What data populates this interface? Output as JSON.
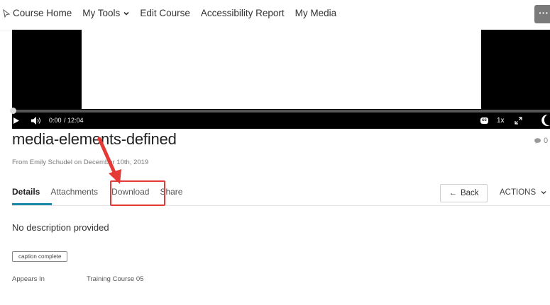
{
  "nav": {
    "items": [
      {
        "label": "Course Home"
      },
      {
        "label": "My Tools"
      },
      {
        "label": "Edit Course"
      },
      {
        "label": "Accessibility Report"
      },
      {
        "label": "My Media"
      }
    ],
    "more_label": "···"
  },
  "player": {
    "current_time": "0:00",
    "duration": "/ 12:04",
    "speed": "1x",
    "cc": "cc",
    "progress": 0
  },
  "media": {
    "title": "media-elements-defined",
    "comment_count": "0",
    "meta": "From Emily Schudel on December 10th, 2019"
  },
  "tabs": [
    {
      "label": "Details",
      "active": true
    },
    {
      "label": "Attachments",
      "active": false
    },
    {
      "label": "Download",
      "active": false
    },
    {
      "label": "Share",
      "active": false
    }
  ],
  "buttons": {
    "back": "Back",
    "actions": "ACTIONS"
  },
  "details": {
    "description": "No description provided",
    "badge": "caption complete",
    "appears_in_label": "Appears In",
    "appears_in_value": "Training Course 05"
  },
  "colors": {
    "accent": "#1b8aa6",
    "annotation": "#e53935"
  }
}
